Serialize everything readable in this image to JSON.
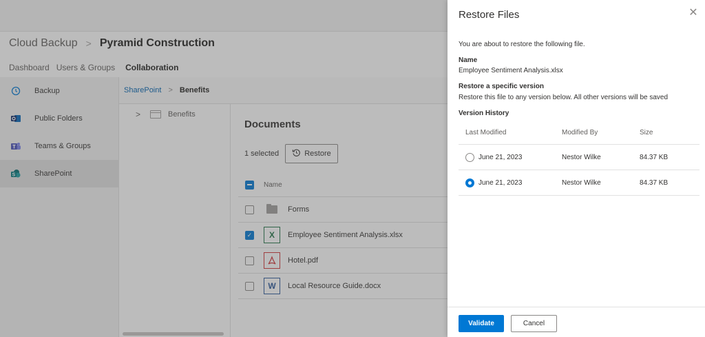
{
  "app": {
    "breadcrumb": {
      "root": "Cloud Backup",
      "current": "Pyramid Construction"
    },
    "tabs": [
      {
        "label": "Dashboard"
      },
      {
        "label": "Users & Groups"
      },
      {
        "label": "Collaboration"
      }
    ],
    "sidebar": {
      "items": [
        {
          "label": "Backup",
          "icon": "backup-history-icon"
        },
        {
          "label": "Public Folders",
          "icon": "outlook-icon"
        },
        {
          "label": "Teams & Groups",
          "icon": "teams-icon"
        },
        {
          "label": "SharePoint",
          "icon": "sharepoint-icon"
        }
      ]
    },
    "subcrumb": {
      "link": "SharePoint",
      "current": "Benefits"
    },
    "tree": {
      "item": "Benefits"
    },
    "documents": {
      "title": "Documents",
      "selected_count": "1 selected",
      "restore_label": "Restore",
      "column_name": "Name",
      "rows": [
        {
          "name": "Forms",
          "type": "folder"
        },
        {
          "name": "Employee Sentiment Analysis.xlsx",
          "type": "xlsx"
        },
        {
          "name": "Hotel.pdf",
          "type": "pdf"
        },
        {
          "name": "Local Resource Guide.docx",
          "type": "docx"
        }
      ]
    }
  },
  "panel": {
    "title": "Restore Files",
    "intro": "You are about to restore the following file.",
    "name_label": "Name",
    "file_name": "Employee Sentiment Analysis.xlsx",
    "version_label": "Restore a specific version",
    "version_desc": "Restore this file to any version below. All other versions will be saved",
    "history_label": "Version History",
    "columns": {
      "modified": "Last Modified",
      "by": "Modified By",
      "size": "Size"
    },
    "versions": [
      {
        "date": "June 21, 2023",
        "by": "Nestor Wilke",
        "size": "84.37 KB",
        "selected": false
      },
      {
        "date": "June 21, 2023",
        "by": "Nestor Wilke",
        "size": "84.37 KB",
        "selected": true
      }
    ],
    "validate_label": "Validate",
    "cancel_label": "Cancel"
  },
  "colors": {
    "accent": "#0078d4",
    "excel": "#217346",
    "pdf": "#d13438",
    "word": "#2b579a"
  }
}
